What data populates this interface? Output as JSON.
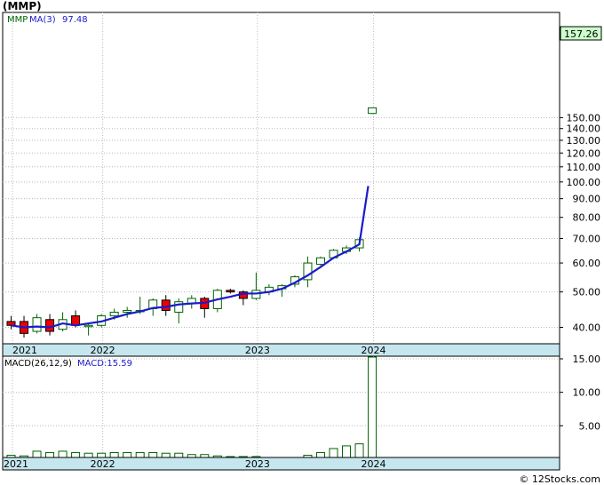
{
  "title": "(MMP)",
  "legend": {
    "symbol": "MMP",
    "ma_label": "MA(3)",
    "ma_value": "97.48"
  },
  "macd_legend": {
    "label": "MACD(26,12,9)",
    "value_label": "MACD:15.59"
  },
  "watermark": "© 12Stocks.com",
  "last_price_label": "157.26",
  "colors": {
    "up_candle_border": "#006400",
    "down_candle_fill": "#ee0000",
    "ma_line": "#1a1acc",
    "macd_bar_border": "#006400",
    "axis_band": "#c5e6ee",
    "price_tag": "#ccffcc",
    "grid": "#bbbbbb"
  },
  "chart_data": [
    {
      "type": "candlestick",
      "title": "(MMP)",
      "y_scale": "log",
      "y_ticks": [
        40,
        50,
        60,
        70,
        80,
        90,
        100,
        110,
        120,
        130,
        140,
        150
      ],
      "y_tick_labels": [
        "40.00",
        "50.00",
        "60.00",
        "70.00",
        "80.00",
        "90.00",
        "100.00",
        "110.00",
        "120.00",
        "130.00",
        "140.00",
        "150.00"
      ],
      "x_labels": [
        "2021",
        "2022",
        "2023",
        "2024"
      ],
      "series": [
        {
          "name": "MMP",
          "candles": [
            {
              "o": 41.5,
              "h": 43.0,
              "l": 39.5,
              "c": 40.5
            },
            {
              "o": 41.5,
              "h": 43.0,
              "l": 37.5,
              "c": 38.5
            },
            {
              "o": 39.0,
              "h": 43.5,
              "l": 38.5,
              "c": 42.5
            },
            {
              "o": 42.0,
              "h": 43.5,
              "l": 38.0,
              "c": 39.0
            },
            {
              "o": 39.5,
              "h": 44.0,
              "l": 39.0,
              "c": 42.0
            },
            {
              "o": 43.0,
              "h": 44.5,
              "l": 40.0,
              "c": 40.5
            },
            {
              "o": 40.5,
              "h": 41.0,
              "l": 38.0,
              "c": 40.5
            },
            {
              "o": 40.5,
              "h": 43.5,
              "l": 40.0,
              "c": 43.0
            },
            {
              "o": 43.0,
              "h": 45.0,
              "l": 42.0,
              "c": 44.0
            },
            {
              "o": 44.0,
              "h": 45.5,
              "l": 42.5,
              "c": 44.5
            },
            {
              "o": 44.5,
              "h": 48.5,
              "l": 43.5,
              "c": 44.5
            },
            {
              "o": 45.0,
              "h": 48.0,
              "l": 43.0,
              "c": 47.5
            },
            {
              "o": 47.5,
              "h": 49.0,
              "l": 43.0,
              "c": 44.5
            },
            {
              "o": 44.0,
              "h": 48.0,
              "l": 41.0,
              "c": 47.0
            },
            {
              "o": 46.5,
              "h": 49.0,
              "l": 45.0,
              "c": 48.0
            },
            {
              "o": 48.0,
              "h": 48.5,
              "l": 42.5,
              "c": 45.0
            },
            {
              "o": 45.0,
              "h": 51.0,
              "l": 44.0,
              "c": 50.5
            },
            {
              "o": 50.5,
              "h": 51.0,
              "l": 49.5,
              "c": 50.0
            },
            {
              "o": 50.0,
              "h": 50.5,
              "l": 46.0,
              "c": 48.0
            },
            {
              "o": 48.0,
              "h": 56.5,
              "l": 47.5,
              "c": 50.5
            },
            {
              "o": 50.0,
              "h": 52.5,
              "l": 49.0,
              "c": 51.5
            },
            {
              "o": 51.0,
              "h": 52.5,
              "l": 48.5,
              "c": 52.0
            },
            {
              "o": 52.5,
              "h": 55.5,
              "l": 51.5,
              "c": 55.0
            },
            {
              "o": 54.0,
              "h": 62.5,
              "l": 51.5,
              "c": 60.0
            },
            {
              "o": 59.5,
              "h": 62.5,
              "l": 59.0,
              "c": 62.0
            },
            {
              "o": 62.0,
              "h": 65.5,
              "l": 61.5,
              "c": 65.0
            },
            {
              "o": 64.5,
              "h": 67.0,
              "l": 63.5,
              "c": 66.0
            },
            {
              "o": 66.0,
              "h": 70.5,
              "l": 64.5,
              "c": 69.5
            },
            {
              "o": 154.0,
              "h": 160.0,
              "l": 153.5,
              "c": 159.5
            }
          ]
        },
        {
          "name": "MA(3)",
          "values": [
            40.5,
            40.0,
            40.2,
            40.0,
            41.0,
            40.5,
            41.0,
            41.5,
            42.5,
            43.5,
            44.2,
            45.2,
            45.5,
            46.2,
            46.5,
            46.7,
            47.7,
            48.5,
            49.5,
            49.5,
            50.0,
            51.0,
            53.0,
            55.5,
            58.5,
            62.0,
            64.5,
            67.5,
            97.48
          ]
        }
      ]
    },
    {
      "type": "bar",
      "title": "MACD(26,12,9)",
      "y_ticks": [
        5,
        10,
        15
      ],
      "y_tick_labels": [
        "5.00",
        "10.00",
        "15.00"
      ],
      "x_labels": [
        "2021",
        "2022",
        "2023",
        "2024"
      ],
      "series": [
        {
          "name": "MACD",
          "values": [
            0.6,
            0.5,
            1.2,
            1.0,
            1.2,
            1.0,
            0.9,
            0.9,
            1.0,
            1.0,
            1.0,
            1.0,
            0.9,
            0.9,
            0.7,
            0.7,
            0.5,
            0.4,
            0.4,
            0.4,
            0.0,
            0.0,
            0.0,
            0.6,
            1.0,
            1.6,
            2.0,
            2.3,
            15.59
          ]
        }
      ]
    }
  ]
}
